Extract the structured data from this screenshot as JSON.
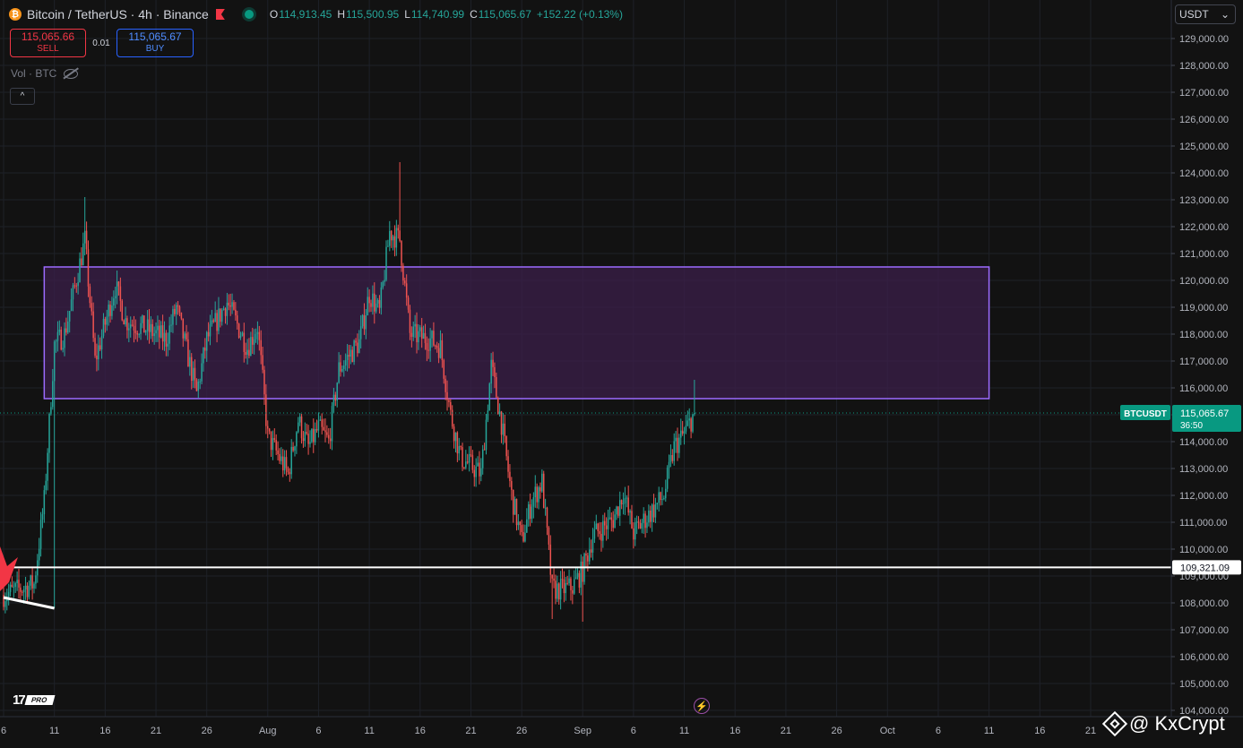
{
  "header": {
    "coin_letter": "₿",
    "symbol_text": "Bitcoin / TetherUS · 4h · Binance",
    "ohlc": {
      "o_key": "O",
      "o_val": "114,913.45",
      "h_key": "H",
      "h_val": "115,500.95",
      "l_key": "L",
      "l_val": "114,740.99",
      "c_key": "C",
      "c_val": "115,065.67",
      "change": "+152.22 (+0.13%)"
    }
  },
  "trade": {
    "sell_price": "115,065.66",
    "sell_label": "SELL",
    "spread": "0.01",
    "buy_price": "115,065.67",
    "buy_label": "BUY"
  },
  "volume_label": "Vol · BTC",
  "collapse_glyph": "^",
  "currency": {
    "value": "USDT",
    "chevron": "⌄"
  },
  "watermark": {
    "text": "@ KxCrypt"
  },
  "logo": {
    "mark": "17",
    "pro": "PRO"
  },
  "bolt_glyph": "⚡",
  "colors": {
    "up": "#26a69a",
    "down": "#ef5350",
    "zone_border": "#9c6bff",
    "zone_fill": "#3b1f4a",
    "last_price_bg": "#089981"
  },
  "chart_data": {
    "type": "candlestick",
    "ylim": [
      103800,
      129800
    ],
    "y_ticks": [
      104000,
      105000,
      106000,
      107000,
      108000,
      109000,
      110000,
      111000,
      112000,
      113000,
      114000,
      115000,
      116000,
      117000,
      118000,
      119000,
      120000,
      121000,
      122000,
      123000,
      124000,
      125000,
      126000,
      127000,
      128000,
      129000
    ],
    "y_tick_labels": [
      "104,000.00",
      "105,000.00",
      "106,000.00",
      "107,000.00",
      "108,000.00",
      "109,000.00",
      "110,000.00",
      "111,000.00",
      "112,000.00",
      "113,000.00",
      "114,000.00",
      "115,000.00",
      "116,000.00",
      "117,000.00",
      "118,000.00",
      "119,000.00",
      "120,000.00",
      "121,000.00",
      "122,000.00",
      "123,000.00",
      "124,000.00",
      "125,000.00",
      "126,000.00",
      "127,000.00",
      "128,000.00",
      "129,000.00"
    ],
    "x_axis_start": "2025-07-06",
    "x_axis_end": "2025-10-21",
    "x_ticks": [
      {
        "date": "2025-07-06",
        "label": "6"
      },
      {
        "date": "2025-07-11",
        "label": "11"
      },
      {
        "date": "2025-07-16",
        "label": "16"
      },
      {
        "date": "2025-07-21",
        "label": "21"
      },
      {
        "date": "2025-07-26",
        "label": "26"
      },
      {
        "date": "2025-08-01",
        "label": "Aug"
      },
      {
        "date": "2025-08-06",
        "label": "6"
      },
      {
        "date": "2025-08-11",
        "label": "11"
      },
      {
        "date": "2025-08-16",
        "label": "16"
      },
      {
        "date": "2025-08-21",
        "label": "21"
      },
      {
        "date": "2025-08-26",
        "label": "26"
      },
      {
        "date": "2025-09-01",
        "label": "Sep"
      },
      {
        "date": "2025-09-06",
        "label": "6"
      },
      {
        "date": "2025-09-11",
        "label": "11"
      },
      {
        "date": "2025-09-16",
        "label": "16"
      },
      {
        "date": "2025-09-21",
        "label": "21"
      },
      {
        "date": "2025-09-26",
        "label": "26"
      },
      {
        "date": "2025-10-01",
        "label": "Oct"
      },
      {
        "date": "2025-10-06",
        "label": "6"
      },
      {
        "date": "2025-10-11",
        "label": "11"
      },
      {
        "date": "2025-10-16",
        "label": "16"
      },
      {
        "date": "2025-10-21",
        "label": "21"
      }
    ],
    "series": [
      {
        "name": "BTCUSDT",
        "anchors": [
          [
            "2025-07-06",
            108300
          ],
          [
            "2025-07-09",
            108700
          ],
          [
            "2025-07-10",
            111800
          ],
          [
            "2025-07-11",
            117600
          ],
          [
            "2025-07-12",
            118000
          ],
          [
            "2025-07-14",
            121500
          ],
          [
            "2025-07-15",
            117000
          ],
          [
            "2025-07-17",
            119800
          ],
          [
            "2025-07-18",
            118500
          ],
          [
            "2025-07-20",
            118200
          ],
          [
            "2025-07-22",
            117800
          ],
          [
            "2025-07-23",
            119000
          ],
          [
            "2025-07-25",
            115800
          ],
          [
            "2025-07-26",
            117800
          ],
          [
            "2025-07-28",
            119200
          ],
          [
            "2025-07-30",
            117500
          ],
          [
            "2025-07-31",
            118300
          ],
          [
            "2025-08-01",
            114200
          ],
          [
            "2025-08-03",
            112800
          ],
          [
            "2025-08-04",
            114800
          ],
          [
            "2025-08-05",
            113800
          ],
          [
            "2025-08-06",
            114500
          ],
          [
            "2025-08-07",
            114000
          ],
          [
            "2025-08-08",
            116700
          ],
          [
            "2025-08-10",
            117700
          ],
          [
            "2025-08-11",
            119500
          ],
          [
            "2025-08-12",
            118800
          ],
          [
            "2025-08-13",
            121800
          ],
          [
            "2025-08-14",
            121500
          ],
          [
            "2025-08-15",
            118000
          ],
          [
            "2025-08-17",
            117800
          ],
          [
            "2025-08-18",
            117500
          ],
          [
            "2025-08-19",
            115000
          ],
          [
            "2025-08-20",
            113400
          ],
          [
            "2025-08-22",
            112800
          ],
          [
            "2025-08-23",
            116800
          ],
          [
            "2025-08-24",
            114700
          ],
          [
            "2025-08-25",
            112000
          ],
          [
            "2025-08-26",
            110300
          ],
          [
            "2025-08-27",
            111800
          ],
          [
            "2025-08-28",
            112500
          ],
          [
            "2025-08-29",
            108500
          ],
          [
            "2025-08-30",
            108500
          ],
          [
            "2025-08-31",
            108600
          ],
          [
            "2025-09-01",
            109200
          ],
          [
            "2025-09-02",
            110500
          ],
          [
            "2025-09-04",
            111100
          ],
          [
            "2025-09-05",
            112100
          ],
          [
            "2025-09-06",
            110600
          ],
          [
            "2025-09-08",
            111500
          ],
          [
            "2025-09-09",
            112000
          ],
          [
            "2025-09-10",
            113800
          ],
          [
            "2025-09-11",
            114300
          ],
          [
            "2025-09-12",
            115065.67
          ]
        ],
        "extremes": [
          [
            "2025-07-11",
            107800,
            "low"
          ],
          [
            "2025-07-14",
            123100,
            "high"
          ],
          [
            "2025-08-14",
            124400,
            "high"
          ],
          [
            "2025-08-29",
            107400,
            "low"
          ],
          [
            "2025-09-01",
            107300,
            "low"
          ],
          [
            "2025-09-12",
            116300,
            "high"
          ]
        ]
      }
    ],
    "annotations": {
      "resistance_zone": {
        "from": "2025-07-10",
        "to": "2025-10-11",
        "low": 115600,
        "high": 120500
      },
      "support_line": {
        "value": 109321.09,
        "label": "109,321.09"
      },
      "trendline": {
        "from": [
          "2025-07-06",
          108200
        ],
        "to": [
          "2025-07-11",
          107800
        ]
      },
      "last_price": {
        "value": 115065.67,
        "label": "115,065.67",
        "symbol": "BTCUSDT",
        "countdown": "36:50"
      }
    }
  }
}
